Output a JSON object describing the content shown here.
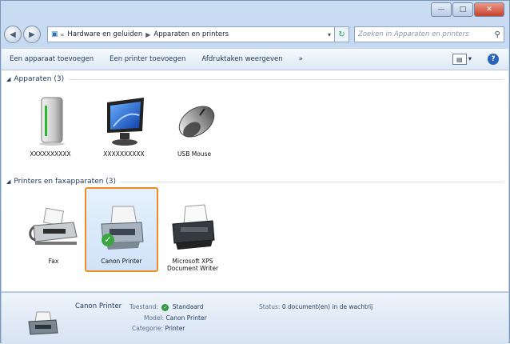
{
  "address": {
    "path": [
      "Hardware en geluiden",
      "Apparaten en printers"
    ],
    "search_placeholder": "Zoeken in Apparaten en printers"
  },
  "toolbar": {
    "add_device": "Een apparaat toevoegen",
    "add_printer": "Een printer toevoegen",
    "print_queue": "Afdruktaken weergeven",
    "more": "»"
  },
  "groups": {
    "devices": {
      "label": "Apparaten (3)"
    },
    "printers": {
      "label": "Printers en faxapparaten (3)"
    }
  },
  "devices": [
    {
      "label": "XXXXXXXXXX"
    },
    {
      "label": "XXXXXXXXXX"
    },
    {
      "label": "USB Mouse"
    }
  ],
  "printers": [
    {
      "label": "Fax"
    },
    {
      "label": "Canon Printer"
    },
    {
      "label": "Microsoft XPS Document Writer"
    }
  ],
  "details": {
    "name": "Canon Printer",
    "state_label": "Toestand:",
    "state_value": "Standaard",
    "model_label": "Model:",
    "model_value": "Canon Printer",
    "category_label": "Categorie:",
    "category_value": "Printer",
    "status_label": "Status:",
    "status_value": "0 document(en) in de wachtrij"
  }
}
